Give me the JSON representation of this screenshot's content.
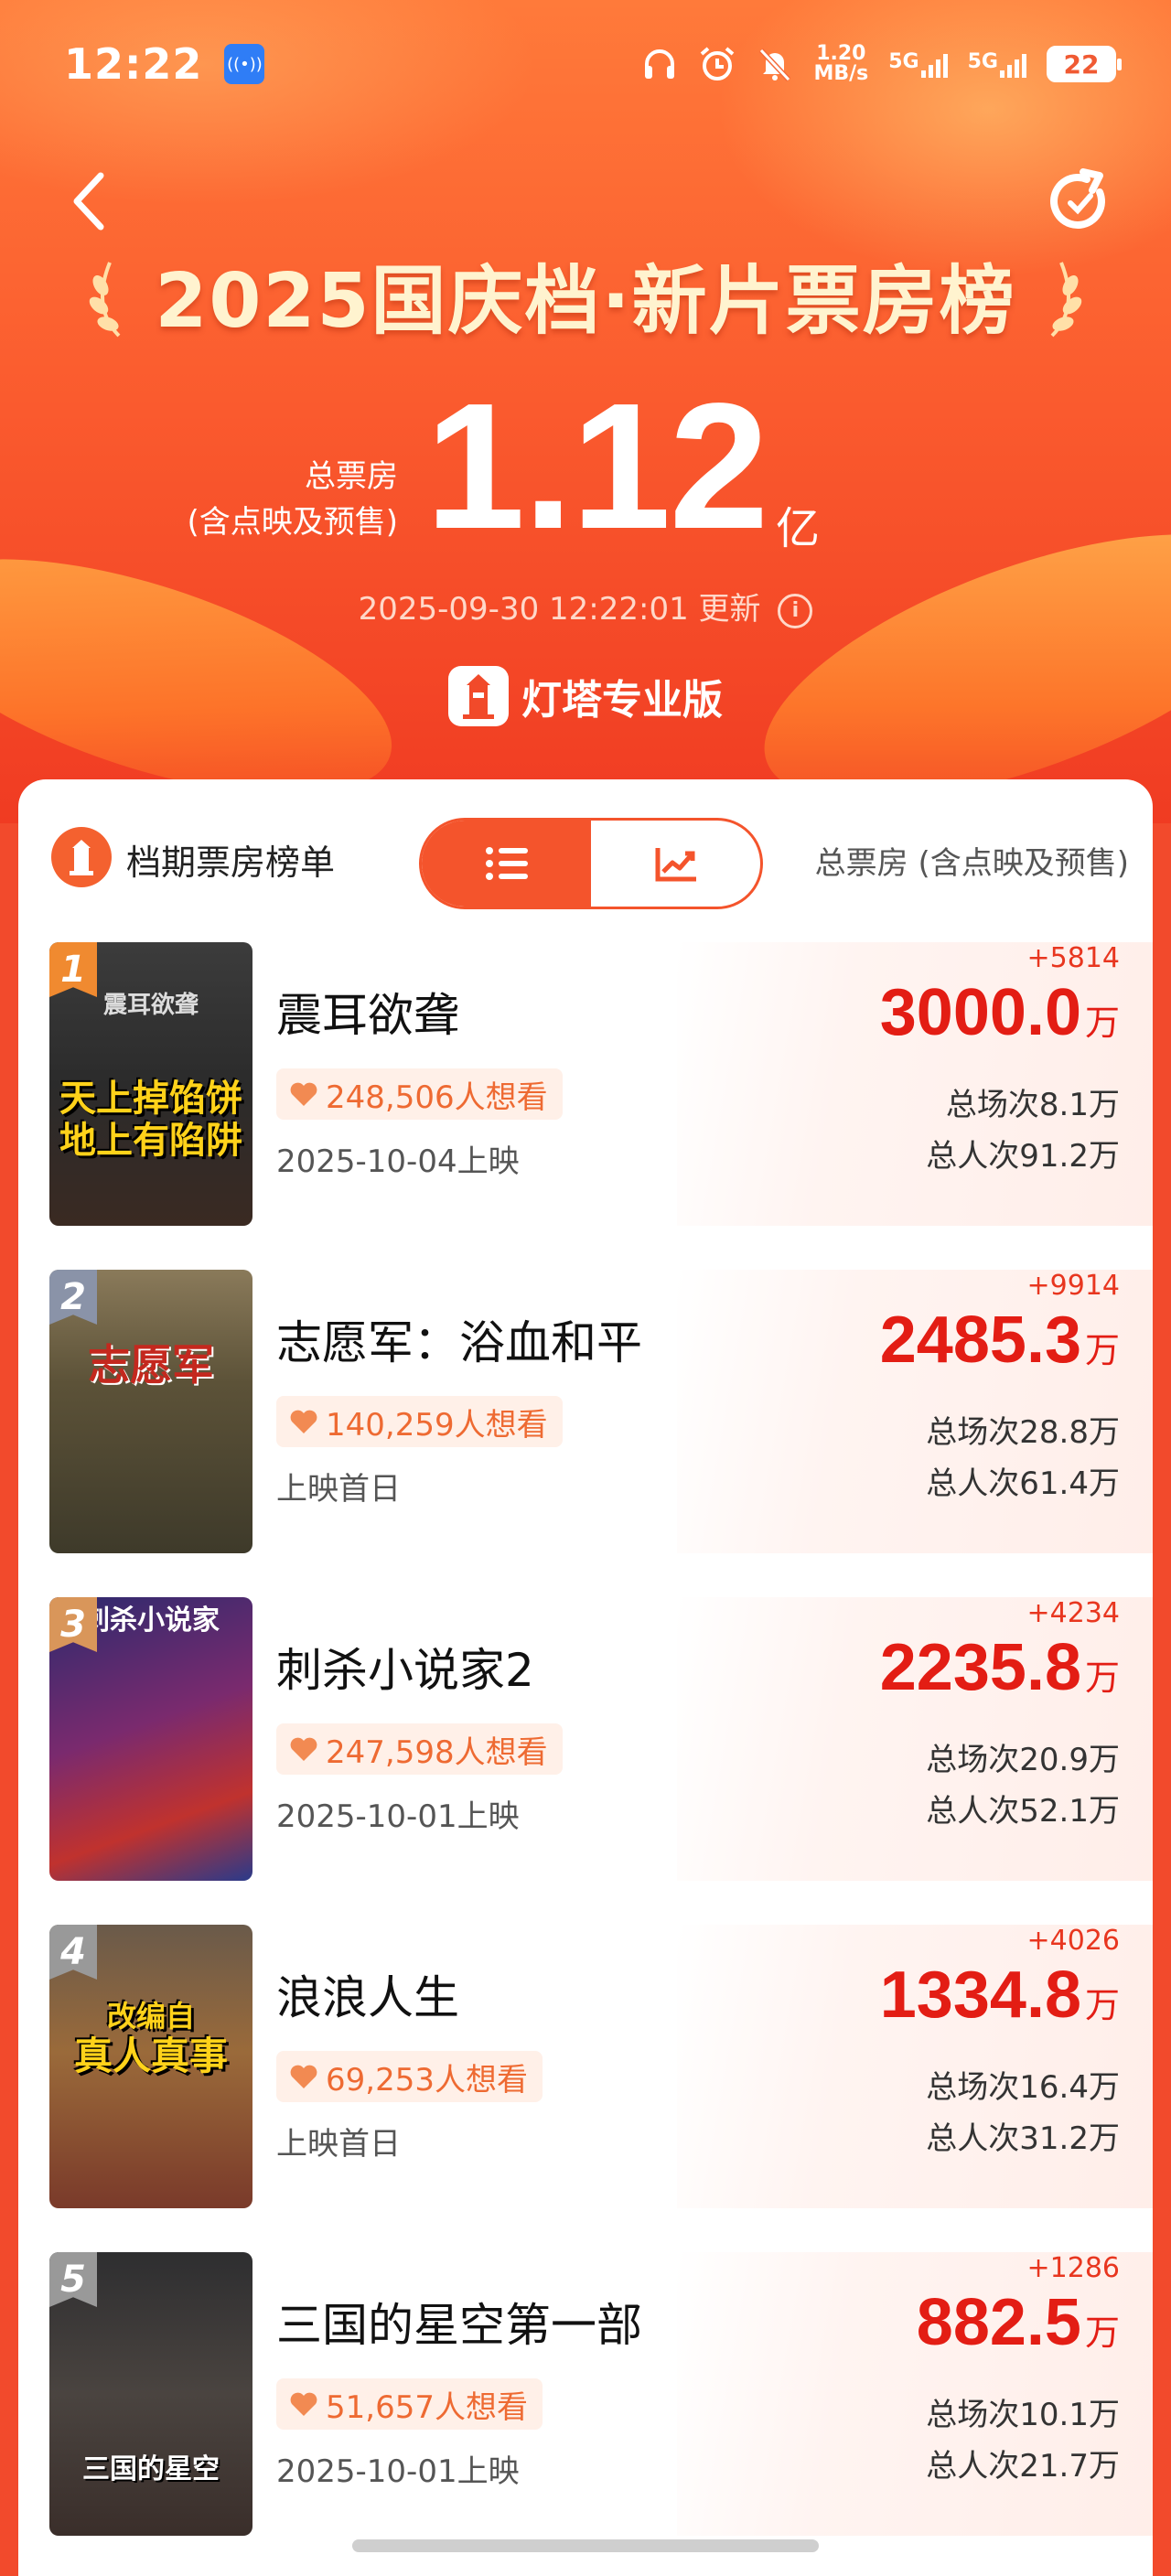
{
  "status_bar": {
    "time": "12:22",
    "app_badge": "((•))",
    "speed_value": "1.20",
    "speed_unit": "MB/s",
    "sim1": "5G",
    "sim2": "5G",
    "battery": "22"
  },
  "header": {
    "title": "2025国庆档·新片票房榜",
    "total_label_line1": "总票房",
    "total_label_line2": "(含点映及预售)",
    "total_value": "1.12",
    "total_unit": "亿",
    "update_time": "2025-09-30 12:22:01 更新",
    "brand": "灯塔专业版"
  },
  "section": {
    "title": "档期票房榜单",
    "right_label": "总票房 (含点映及预售)",
    "active_view": "list"
  },
  "colors": {
    "accent": "#f4542c",
    "gross": "#e31d14",
    "rank1": "#f08a30",
    "rank2": "#8a93a8",
    "rank3": "#d9965a",
    "rank4": "#999999"
  },
  "movies": [
    {
      "rank": "1",
      "title": "震耳欲聋",
      "wants": "248,506人想看",
      "release": "2025-10-04上映",
      "delta": "+5814",
      "gross": "3000.0",
      "unit": "万",
      "shows": "总场次8.1万",
      "admissions": "总人次91.2万",
      "poster_small": "震耳欲聋",
      "poster_line1": "天上掉馅饼",
      "poster_line2": "地上有陷阱"
    },
    {
      "rank": "2",
      "title": "志愿军：浴血和平",
      "wants": "140,259人想看",
      "release": "上映首日",
      "delta": "+9914",
      "gross": "2485.3",
      "unit": "万",
      "shows": "总场次28.8万",
      "admissions": "总人次61.4万",
      "poster_small": "",
      "poster_line1": "志愿军",
      "poster_line2": ""
    },
    {
      "rank": "3",
      "title": "刺杀小说家2",
      "wants": "247,598人想看",
      "release": "2025-10-01上映",
      "delta": "+4234",
      "gross": "2235.8",
      "unit": "万",
      "shows": "总场次20.9万",
      "admissions": "总人次52.1万",
      "poster_small": "",
      "poster_line1": "刺杀小说家",
      "poster_line2": ""
    },
    {
      "rank": "4",
      "title": "浪浪人生",
      "wants": "69,253人想看",
      "release": "上映首日",
      "delta": "+4026",
      "gross": "1334.8",
      "unit": "万",
      "shows": "总场次16.4万",
      "admissions": "总人次31.2万",
      "poster_small": "",
      "poster_line1": "改编自",
      "poster_line2": "真人真事"
    },
    {
      "rank": "5",
      "title": "三国的星空第一部",
      "wants": "51,657人想看",
      "release": "2025-10-01上映",
      "delta": "+1286",
      "gross": "882.5",
      "unit": "万",
      "shows": "总场次10.1万",
      "admissions": "总人次21.7万",
      "poster_small": "",
      "poster_line1": "三国的星空",
      "poster_line2": ""
    }
  ]
}
